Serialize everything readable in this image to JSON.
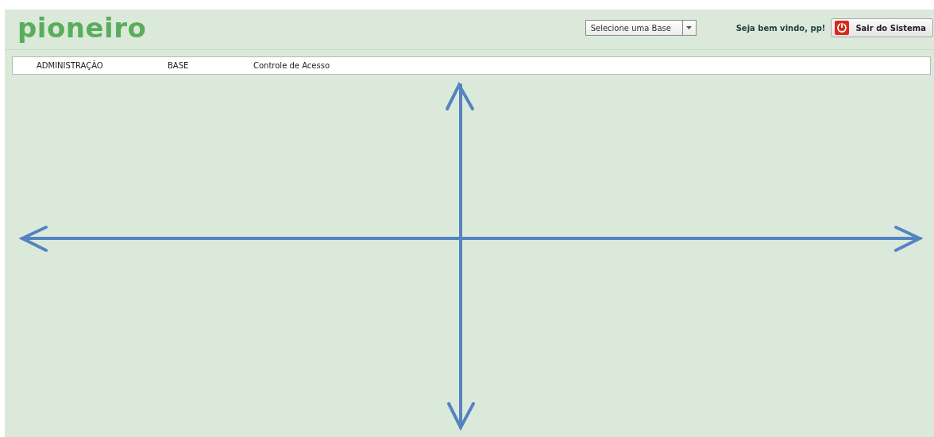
{
  "header": {
    "logo": "pioneiro",
    "base_select": {
      "value": "Selecione uma Base"
    },
    "welcome": "Seja bem vindo, pp!",
    "logout_button": "Sair do Sistema"
  },
  "menu": [
    {
      "label": "ADMINISTRAÇÃO"
    },
    {
      "label": "BASE"
    },
    {
      "label": "Controle de Acesso"
    }
  ]
}
